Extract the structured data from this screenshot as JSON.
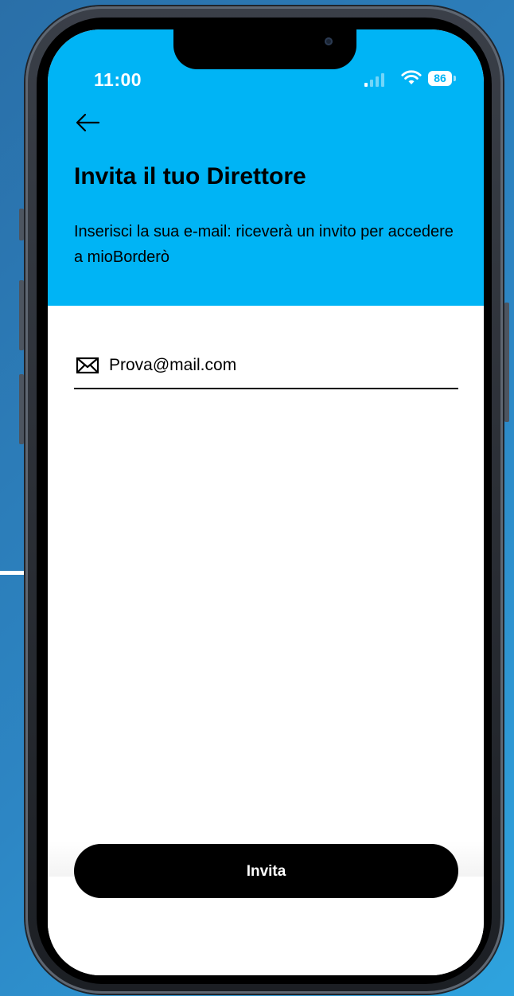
{
  "status_bar": {
    "time": "11:00",
    "battery_level": "86",
    "signal_icon": "cellular-signal-icon",
    "wifi_icon": "wifi-icon"
  },
  "header": {
    "back_icon": "arrow-left-icon",
    "title": "Invita il tuo Direttore",
    "subtitle": "Inserisci la sua e-mail: riceverà un invito per accedere a mioBorderò"
  },
  "form": {
    "email_icon": "mail-icon",
    "email_value": "Prova@mail.com"
  },
  "footer": {
    "invite_label": "Invita"
  },
  "colors": {
    "header_bg": "#00b4f5",
    "button_bg": "#000000",
    "button_text": "#ffffff"
  }
}
